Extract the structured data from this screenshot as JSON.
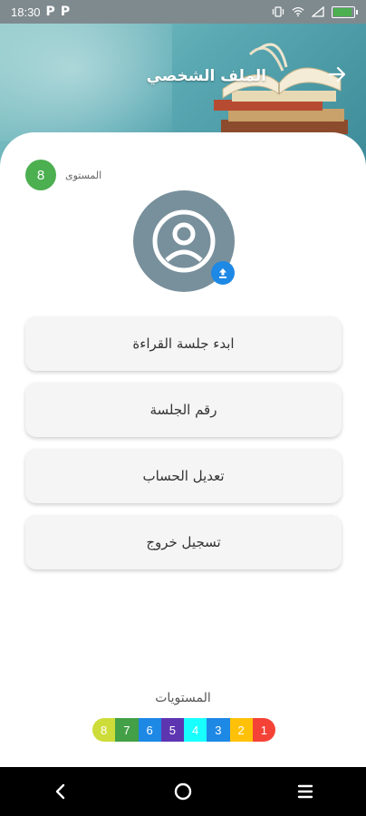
{
  "status_bar": {
    "time": "18:30",
    "left_icons": [
      "P",
      "P"
    ]
  },
  "header": {
    "title": "الملف الشخصي",
    "back_icon": "arrow-right-icon"
  },
  "profile": {
    "level_label": "المستوى",
    "level_value": "8",
    "avatar_icon": "person-icon",
    "upload_icon": "upload-icon"
  },
  "menu": [
    {
      "label": "ابدء جلسة القراءة"
    },
    {
      "label": "رقم الجلسة"
    },
    {
      "label": "تعديل الحساب"
    },
    {
      "label": "تسجيل خروج"
    }
  ],
  "levels": {
    "title": "المستويات",
    "items": [
      {
        "label": "8",
        "color": "#cddc39"
      },
      {
        "label": "7",
        "color": "#43a047"
      },
      {
        "label": "6",
        "color": "#1e88e5"
      },
      {
        "label": "5",
        "color": "#5e35b1"
      },
      {
        "label": "4",
        "color": "#18ffff"
      },
      {
        "label": "3",
        "color": "#1e88e5"
      },
      {
        "label": "2",
        "color": "#ffc107"
      },
      {
        "label": "1",
        "color": "#f44336"
      }
    ]
  },
  "colors": {
    "accent_green": "#4caf50",
    "avatar_bg": "#78909c",
    "upload_blue": "#1e88e5"
  }
}
